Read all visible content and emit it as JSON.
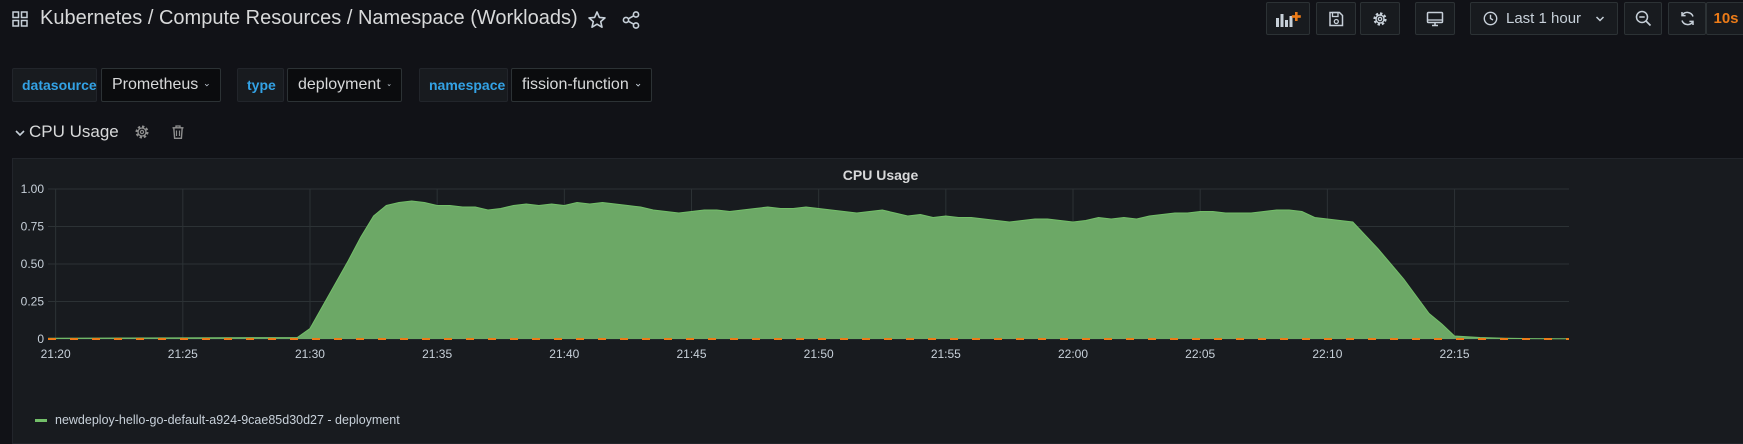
{
  "header": {
    "title": "Kubernetes / Compute Resources / Namespace (Workloads)",
    "time_range": "Last 1 hour",
    "refresh_interval": "10s"
  },
  "variables": [
    {
      "label": "datasource",
      "value": "Prometheus"
    },
    {
      "label": "type",
      "value": "deployment"
    },
    {
      "label": "namespace",
      "value": "fission-function"
    }
  ],
  "row": {
    "title": "CPU Usage"
  },
  "colors": {
    "background": "#111217",
    "panel": "#181b1f",
    "series_fill": "#6ca866",
    "series_line": "#73bf69",
    "threshold_dash": "#eb7b18",
    "accent_label": "#33a2e5"
  },
  "panel": {
    "title": "CPU Usage",
    "legend": "newdeploy-hello-go-default-a924-9cae85d30d27 - deployment"
  },
  "chart_data": {
    "type": "area",
    "title": "CPU Usage",
    "xlabel": "",
    "ylabel": "",
    "x_ticks": [
      "21:20",
      "21:25",
      "21:30",
      "21:35",
      "21:40",
      "21:45",
      "21:50",
      "21:55",
      "22:00",
      "22:05",
      "22:10",
      "22:15"
    ],
    "y_ticks": [
      "0",
      "0.25",
      "0.50",
      "0.75",
      "1.00"
    ],
    "ylim": [
      0,
      1.0
    ],
    "xlim": [
      "21:19:42",
      "22:19:30"
    ],
    "grid": true,
    "legend_position": "bottom-left",
    "series": [
      {
        "name": "newdeploy-hello-go-default-a924-9cae85d30d27 - deployment",
        "x": [
          "21:19:42",
          "21:29:30",
          "21:30:00",
          "21:30:30",
          "21:31:00",
          "21:31:30",
          "21:32:00",
          "21:32:30",
          "21:33:00",
          "21:33:30",
          "21:34:00",
          "21:34:30",
          "21:35:00",
          "21:35:30",
          "21:36:00",
          "21:36:30",
          "21:37:00",
          "21:37:30",
          "21:38:00",
          "21:38:30",
          "21:39:00",
          "21:39:30",
          "21:40:00",
          "21:40:30",
          "21:41:00",
          "21:41:30",
          "21:42:00",
          "21:42:30",
          "21:43:00",
          "21:43:30",
          "21:44:00",
          "21:44:30",
          "21:45:00",
          "21:45:30",
          "21:46:00",
          "21:46:30",
          "21:47:00",
          "21:47:30",
          "21:48:00",
          "21:48:30",
          "21:49:00",
          "21:49:30",
          "21:50:00",
          "21:50:30",
          "21:51:00",
          "21:51:30",
          "21:52:00",
          "21:52:30",
          "21:53:00",
          "21:53:30",
          "21:54:00",
          "21:54:30",
          "21:55:00",
          "21:55:30",
          "21:56:00",
          "21:56:30",
          "21:57:00",
          "21:57:30",
          "21:58:00",
          "21:58:30",
          "21:59:00",
          "21:59:30",
          "22:00:00",
          "22:00:30",
          "22:01:00",
          "22:01:30",
          "22:02:00",
          "22:02:30",
          "22:03:00",
          "22:03:30",
          "22:04:00",
          "22:04:30",
          "22:05:00",
          "22:05:30",
          "22:06:00",
          "22:06:30",
          "22:07:00",
          "22:07:30",
          "22:08:00",
          "22:08:30",
          "22:09:00",
          "22:09:30",
          "22:10:00",
          "22:10:30",
          "22:11:00",
          "22:12:00",
          "22:13:00",
          "22:14:00",
          "22:14:30",
          "22:15:00",
          "22:16:00",
          "22:17:00",
          "22:18:00",
          "22:19:00",
          "22:19:30"
        ],
        "values": [
          0.005,
          0.01,
          0.07,
          0.22,
          0.37,
          0.52,
          0.68,
          0.82,
          0.89,
          0.91,
          0.92,
          0.91,
          0.89,
          0.89,
          0.88,
          0.88,
          0.86,
          0.87,
          0.89,
          0.9,
          0.89,
          0.9,
          0.89,
          0.91,
          0.9,
          0.91,
          0.9,
          0.89,
          0.88,
          0.86,
          0.85,
          0.84,
          0.85,
          0.86,
          0.86,
          0.85,
          0.86,
          0.87,
          0.88,
          0.87,
          0.87,
          0.88,
          0.87,
          0.86,
          0.85,
          0.84,
          0.85,
          0.86,
          0.84,
          0.82,
          0.83,
          0.81,
          0.82,
          0.81,
          0.81,
          0.8,
          0.79,
          0.78,
          0.79,
          0.8,
          0.8,
          0.79,
          0.78,
          0.79,
          0.81,
          0.8,
          0.81,
          0.8,
          0.82,
          0.83,
          0.84,
          0.84,
          0.85,
          0.85,
          0.84,
          0.84,
          0.84,
          0.85,
          0.86,
          0.86,
          0.85,
          0.81,
          0.8,
          0.79,
          0.78,
          0.6,
          0.4,
          0.17,
          0.1,
          0.02,
          0.01,
          0.005,
          0.003,
          0.002,
          0.002
        ]
      }
    ]
  }
}
